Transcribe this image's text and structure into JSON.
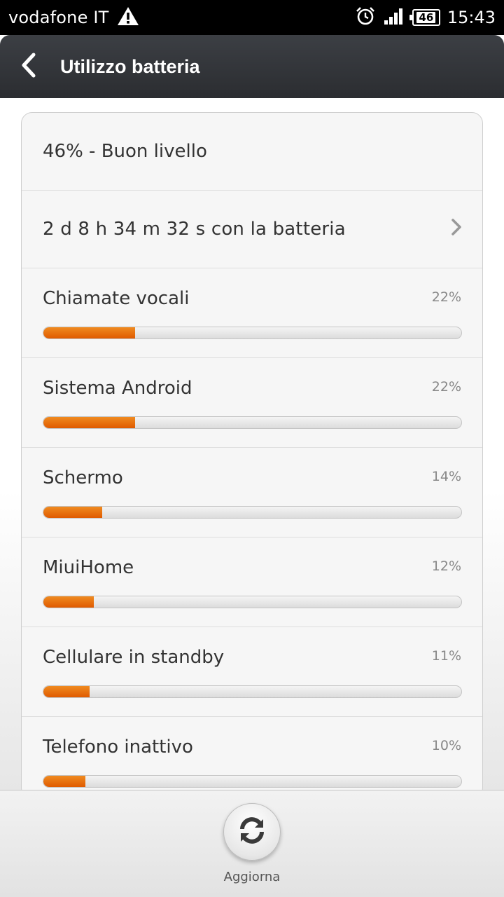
{
  "status_bar": {
    "carrier": "vodafone IT",
    "network_badge": "46",
    "time": "15:43"
  },
  "header": {
    "title": "Utilizzo batteria"
  },
  "summary": {
    "level_text": "46% - Buon livello",
    "time_on_battery": "2 d 8 h 34 m 32 s con la batteria"
  },
  "usage": [
    {
      "label": "Chiamate vocali",
      "percent_text": "22%",
      "fill": 0.22
    },
    {
      "label": "Sistema Android",
      "percent_text": "22%",
      "fill": 0.22
    },
    {
      "label": "Schermo",
      "percent_text": "14%",
      "fill": 0.14
    },
    {
      "label": "MiuiHome",
      "percent_text": "12%",
      "fill": 0.12
    },
    {
      "label": "Cellulare in standby",
      "percent_text": "11%",
      "fill": 0.11
    },
    {
      "label": "Telefono inattivo",
      "percent_text": "10%",
      "fill": 0.1
    }
  ],
  "footer": {
    "refresh_label": "Aggiorna"
  },
  "colors": {
    "accent_orange": "#e8700e",
    "title_bar": "#33363b",
    "status_bar": "#000000"
  }
}
